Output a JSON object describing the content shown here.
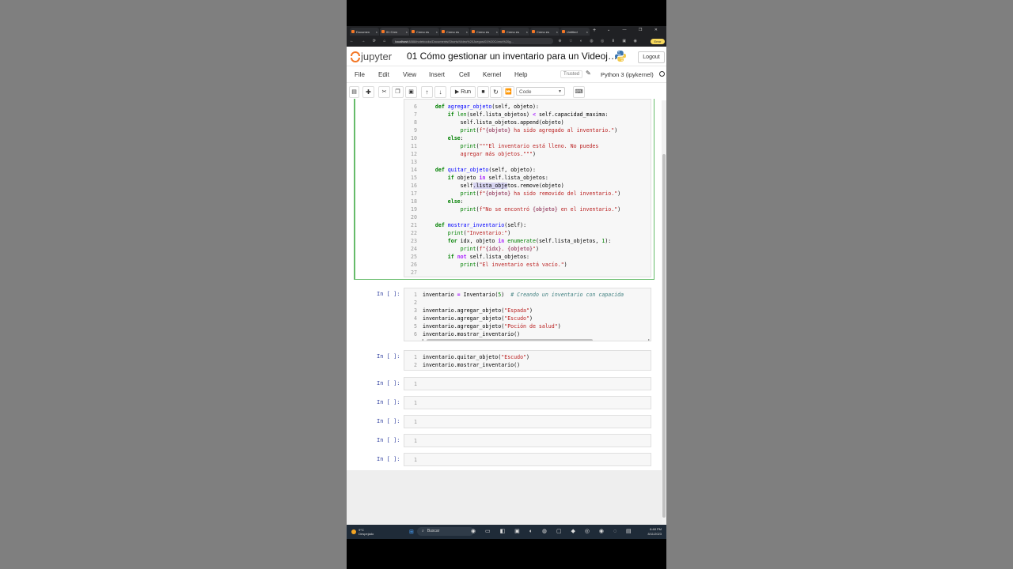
{
  "browser": {
    "tabs": [
      {
        "label": "Documen",
        "active": false
      },
      {
        "label": "01 Cóm",
        "active": true
      },
      {
        "label": "Cómo es",
        "active": false
      },
      {
        "label": "Cómo es",
        "active": false
      },
      {
        "label": "Cómo es",
        "active": false
      },
      {
        "label": "Cómo es",
        "active": false
      },
      {
        "label": "Cómo es",
        "active": false
      },
      {
        "label": "Untitled",
        "active": false
      }
    ],
    "new_tab": "+",
    "window_controls": "⌄ — ❐ ✕",
    "nav_icons": "← → ⟳ ⌂",
    "url_host": "localhost",
    "url_rest": ":8888/notebooks/Documents/Shorts/Video%20Juegos/01%20Cómo%20g...",
    "extension_icons": "⊕ ☆ ◐ ◍ ◎ ⬇ ▣ ◉",
    "error_label": "Error"
  },
  "jupyter": {
    "logo_text": "jupyter",
    "notebook_title": "01 Cómo gestionar un inventario para un Videoj…",
    "logout": "Logout",
    "menu": [
      "File",
      "Edit",
      "View",
      "Insert",
      "Cell",
      "Kernel",
      "Help"
    ],
    "trusted": "Trusted",
    "kernel_name": "Python 3 (ipykernel)",
    "cell_type": "Code",
    "run_label": "Run"
  },
  "cells": [
    {
      "prompt": "",
      "lines": [
        [
          "6",
          "    <span class=\"k\">def</span> <span class=\"f\">agregar_objeto</span>(self, objeto):"
        ],
        [
          "7",
          "        <span class=\"k\">if</span> <span class=\"n\">len</span>(self.lista_objetos) <span class=\"o\">&lt;</span> self.capacidad_maxima:"
        ],
        [
          "8",
          "            self.lista_objetos.append(objeto)"
        ],
        [
          "9",
          "            <span class=\"n\">print</span>(<span class=\"s\">f\"</span><span class=\"i\">{objeto}</span><span class=\"s\"> ha sido agregado al inventario.\"</span>)"
        ],
        [
          "10",
          "        <span class=\"k\">else</span>:"
        ],
        [
          "11",
          "            <span class=\"n\">print</span>(<span class=\"s\">\"\"\"El inventario está lleno. No puedes</span>"
        ],
        [
          "12",
          "<span class=\"s\">            agregar más objetos.\"\"\"</span>)"
        ],
        [
          "13",
          ""
        ],
        [
          "14",
          "    <span class=\"k\">def</span> <span class=\"f\">quitar_objeto</span>(self, objeto):"
        ],
        [
          "15",
          "        <span class=\"k\">if</span> objeto <span class=\"o\">in</span> self.lista_objetos:"
        ],
        [
          "16",
          "            self<span class=\"hl\">.lista_obje</span>tos.remove(objeto)"
        ],
        [
          "17",
          "            <span class=\"n\">print</span>(<span class=\"s\">f\"</span><span class=\"i\">{objeto}</span><span class=\"s\"> ha sido removido del inventario.\"</span>)"
        ],
        [
          "18",
          "        <span class=\"k\">else</span>:"
        ],
        [
          "19",
          "            <span class=\"n\">print</span>(<span class=\"s\">f\"No se encontró </span><span class=\"i\">{objeto}</span><span class=\"s\"> en el inventario.\"</span>)"
        ],
        [
          "20",
          ""
        ],
        [
          "21",
          "    <span class=\"k\">def</span> <span class=\"f\">mostrar_inventario</span>(self):"
        ],
        [
          "22",
          "        <span class=\"n\">print</span>(<span class=\"s\">\"Inventario:\"</span>)"
        ],
        [
          "23",
          "        <span class=\"k\">for</span> idx, objeto <span class=\"o\">in</span> <span class=\"n\">enumerate</span>(self.lista_objetos, <span class=\"n\">1</span>):"
        ],
        [
          "24",
          "            <span class=\"n\">print</span>(<span class=\"s\">f\"</span><span class=\"i\">{idx}</span><span class=\"s\">. </span><span class=\"i\">{objeto}</span><span class=\"s\">\"</span>)"
        ],
        [
          "25",
          "        <span class=\"k\">if</span> <span class=\"o\">not</span> self.lista_objetos:"
        ],
        [
          "26",
          "            <span class=\"n\">print</span>(<span class=\"s\">\"El inventario está vacío.\"</span>)"
        ],
        [
          "27",
          ""
        ]
      ]
    },
    {
      "prompt": "In [ ]:",
      "lines": [
        [
          "1",
          "inventario <span class=\"o\">=</span> Inventario(<span class=\"n\">5</span>)  <span class=\"c\"># Creando un inventario con capacida</span>"
        ],
        [
          "2",
          ""
        ],
        [
          "3",
          "inventario.agregar_objeto(<span class=\"s\">\"Espada\"</span>)"
        ],
        [
          "4",
          "inventario.agregar_objeto(<span class=\"s\">\"Escudo\"</span>)"
        ],
        [
          "5",
          "inventario.agregar_objeto(<span class=\"s\">\"Poción de salud\"</span>)"
        ],
        [
          "6",
          "inventario.mostrar_inventario()"
        ]
      ]
    },
    {
      "prompt": "In [ ]:",
      "lines": [
        [
          "1",
          "inventario.quitar_objeto(<span class=\"s\">\"Escudo\"</span>)"
        ],
        [
          "2",
          "inventario.mostrar_inventario()"
        ]
      ]
    },
    {
      "prompt": "In [ ]:",
      "lines": [
        [
          "1",
          ""
        ]
      ]
    },
    {
      "prompt": "In [ ]:",
      "lines": [
        [
          "1",
          ""
        ]
      ]
    },
    {
      "prompt": "In [ ]:",
      "lines": [
        [
          "1",
          ""
        ]
      ]
    },
    {
      "prompt": "In [ ]:",
      "lines": [
        [
          "1",
          ""
        ]
      ]
    },
    {
      "prompt": "In [ ]:",
      "lines": [
        [
          "1",
          ""
        ]
      ]
    }
  ],
  "taskbar": {
    "weather_temp": "9°C",
    "weather_desc": "Despejado",
    "search_placeholder": "Buscar",
    "time": "6:48 PM",
    "date": "8/11/2023"
  }
}
